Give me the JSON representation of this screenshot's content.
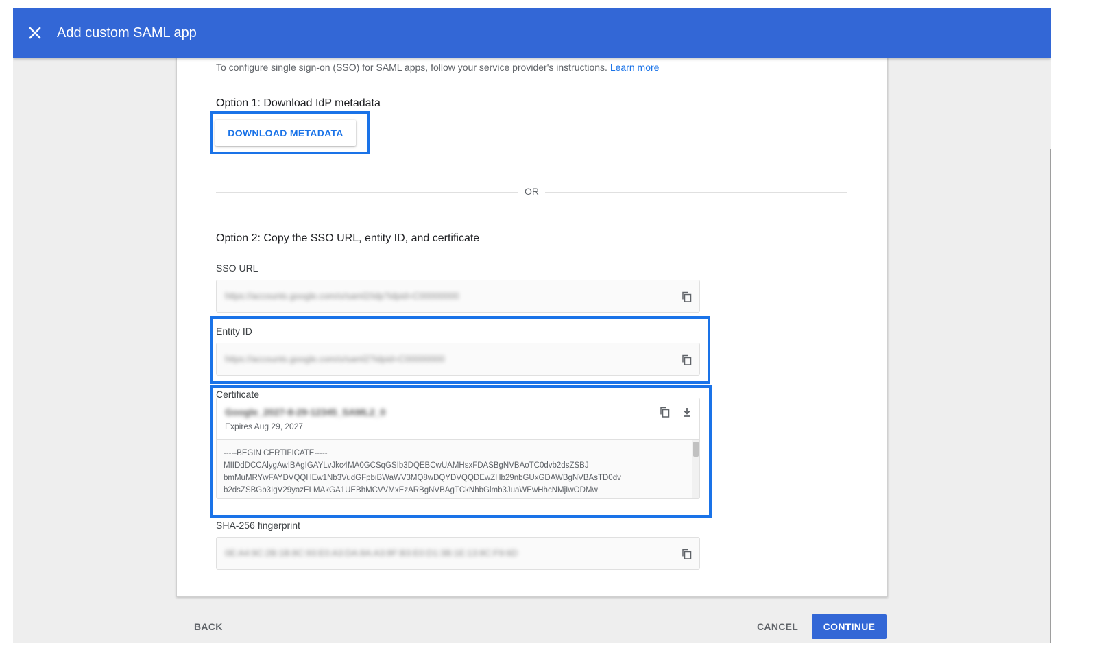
{
  "header": {
    "title": "Add custom SAML app",
    "close_icon": "close-icon"
  },
  "intro": {
    "text": "To configure single sign-on (SSO) for SAML apps, follow your service provider's instructions.",
    "link": "Learn more"
  },
  "option1": {
    "heading": "Option 1: Download IdP metadata",
    "download_button": "DOWNLOAD METADATA"
  },
  "divider": {
    "or": "OR"
  },
  "option2": {
    "heading": "Option 2: Copy the SSO URL, entity ID, and certificate",
    "sso_url": {
      "label": "SSO URL",
      "value": "https://accounts.google.com/o/saml2/idp?idpid=C00000000"
    },
    "entity_id": {
      "label": "Entity ID",
      "value": "https://accounts.google.com/o/saml2?idpid=C00000000"
    },
    "certificate": {
      "label": "Certificate",
      "name": "Google_2027-8-29-12345_SAML2_0",
      "expires": "Expires Aug 29, 2027",
      "pem_lines": [
        "-----BEGIN CERTIFICATE-----",
        "MIIDdDCCAlygAwIBAgIGAYLvJkc4MA0GCSqGSIb3DQEBCwUAMHsxFDASBgNVBAoTC0dvb2dsZSBJ",
        "bmMuMRYwFAYDVQQHEw1Nb3VudGFpbiBWaWV3MQ8wDQYDVQQDEwZHb29nbGUxGDAWBgNVBAsTD0dv",
        "b2dsZSBGb3IgV29yazELMAkGA1UEBhMCVVMxEzARBgNVBAgTCkNhbGlmb3JuaWEwHhcNMjIwODMw"
      ]
    },
    "fingerprint": {
      "label": "SHA-256 fingerprint",
      "value": "0E:A4:9C:2B:1B:8C:93:E0:A3:DA:8A:A3:8F:B3:E0:D1:3B:1E:13:8C:F9:6D"
    }
  },
  "footer": {
    "back": "BACK",
    "cancel": "CANCEL",
    "continue": "CONTINUE"
  },
  "colors": {
    "header": "#3367d6",
    "accent": "#1a73e8",
    "highlight": "#1a73e8"
  }
}
